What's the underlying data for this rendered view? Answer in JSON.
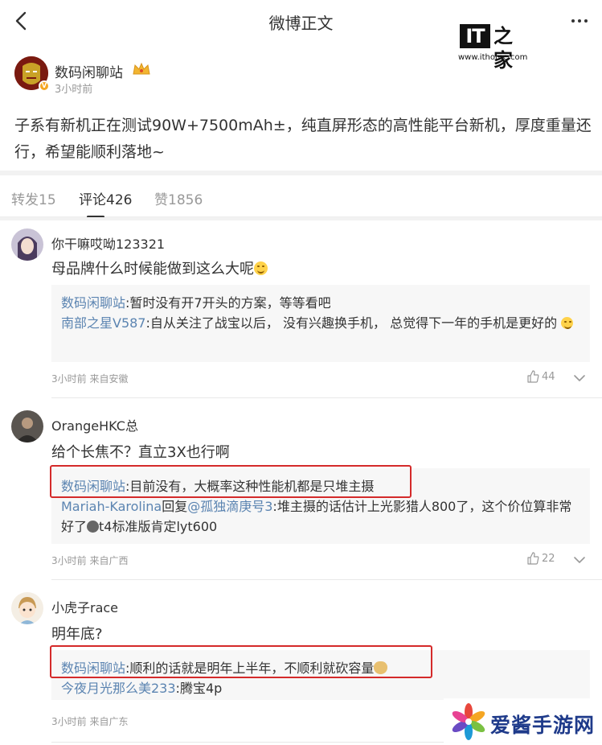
{
  "nav": {
    "title": "微博正文"
  },
  "watermark_it": {
    "logo_text": "IT",
    "logo_cn": "之家",
    "url": "www.ithome.com"
  },
  "post": {
    "author": "数码闲聊站",
    "time": "3小时前",
    "text": "子系有新机正在测试90W+7500mAh±，纯直屏形态的高性能平台新机，厚度重量还行，希望能顺利落地~"
  },
  "tabs": [
    {
      "label": "转发15"
    },
    {
      "label": "评论426"
    },
    {
      "label": "赞1856"
    }
  ],
  "comments": [
    {
      "user": "你干嘛哎呦123321",
      "text": "母品牌什么时候能做到这么大呢",
      "replies": [
        {
          "name": "数码闲聊站",
          "text": ":暂时没有开7开头的方案，等等看吧"
        },
        {
          "name": "南部之星V587",
          "text": ":自从关注了战宝以后， 没有兴趣换手机， 总觉得下一年的手机是更好的"
        }
      ],
      "meta": "3小时前 来自安徽",
      "likes": "44"
    },
    {
      "user": "OrangeHKC总",
      "text": "给个长焦不？直立3X也行啊",
      "replies": [
        {
          "name": "数码闲聊站",
          "text": ":目前没有，大概率这种性能机都是只堆主摄"
        },
        {
          "name": "Mariah-Karolina",
          "mid": "回复",
          "mention": "@孤独滴庚号3",
          "text": ":堆主摄的话估计上光影猎人800了，这个价位算非常好了",
          "tail": "t4标准版肯定lyt600"
        }
      ],
      "meta": "3小时前 来自广西",
      "likes": "22"
    },
    {
      "user": "小虎子race",
      "text": "明年底?",
      "replies": [
        {
          "name": "数码闲聊站",
          "text": ":顺利的话就是明年上半年，不顺利就砍容量"
        },
        {
          "name": "今夜月光那么美233",
          "text": ":腾宝4p"
        }
      ],
      "meta": "3小时前 来自广东"
    }
  ],
  "watermark_site": {
    "text": "爱酱手游网"
  },
  "colors": {
    "link": "#5b84b1",
    "highlight_box": "#d42a2a",
    "muted": "#999999"
  }
}
